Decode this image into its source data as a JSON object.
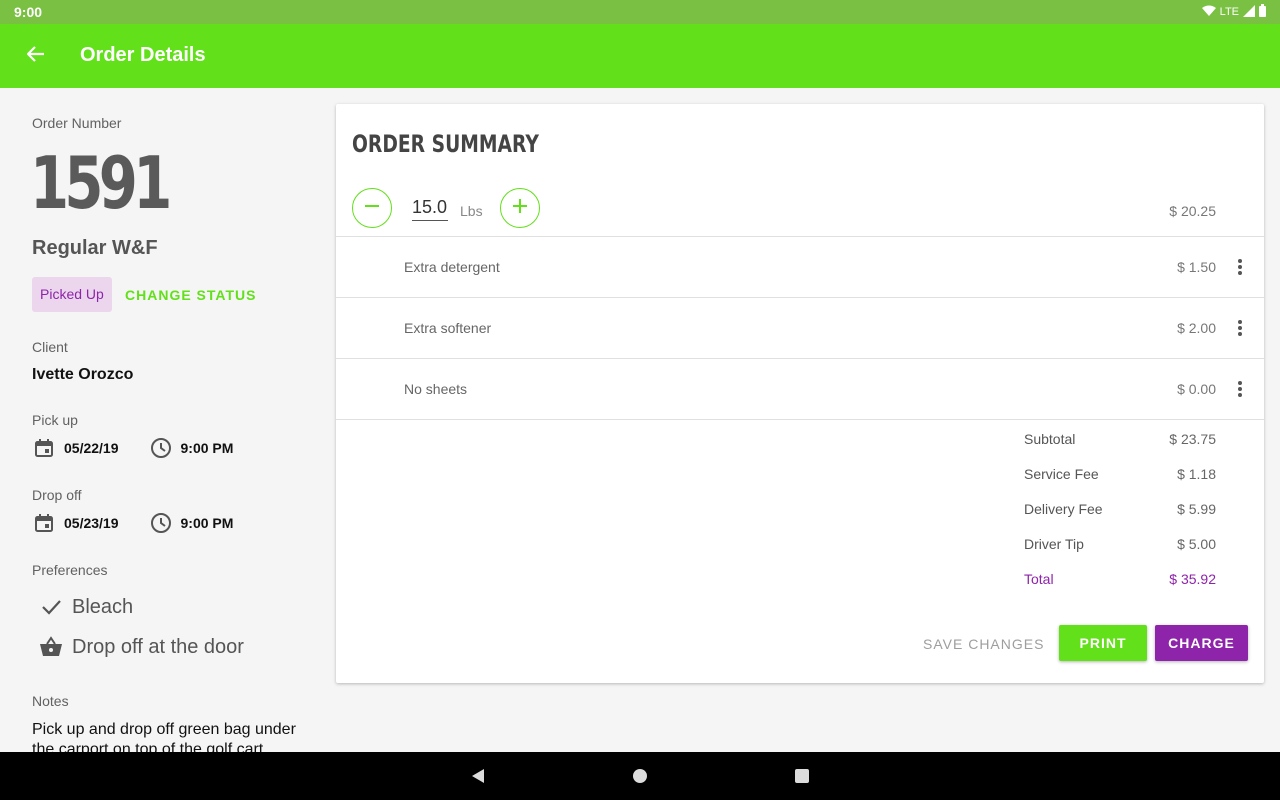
{
  "status_bar": {
    "time": "9:00",
    "network": "LTE"
  },
  "app_bar": {
    "title": "Order Details"
  },
  "order": {
    "number_label": "Order Number",
    "number": "1591",
    "service": "Regular W&F",
    "status": "Picked Up",
    "change_status": "CHANGE STATUS",
    "client_label": "Client",
    "client_name": "Ivette  Orozco",
    "pickup_label": "Pick up",
    "pickup_date": "05/22/19",
    "pickup_time": "9:00 PM",
    "dropoff_label": "Drop off",
    "dropoff_date": "05/23/19",
    "dropoff_time": "9:00 PM",
    "preferences_label": "Preferences",
    "preferences": [
      {
        "icon": "check-icon",
        "text": "Bleach"
      },
      {
        "icon": "basket-icon",
        "text": "Drop off at the door"
      }
    ],
    "notes_label": "Notes",
    "notes": "Pick up and drop off green bag under the carport on top of the golf cart."
  },
  "summary": {
    "title": "ORDER SUMMARY",
    "quantity": "15.0",
    "unit": "Lbs",
    "quantity_price": "$ 20.25",
    "items": [
      {
        "name": "Extra detergent",
        "price": "$ 1.50"
      },
      {
        "name": "Extra softener",
        "price": "$ 2.00"
      },
      {
        "name": "No sheets",
        "price": "$ 0.00"
      }
    ],
    "totals": [
      {
        "label": "Subtotal",
        "value": "$ 23.75"
      },
      {
        "label": "Service Fee",
        "value": "$ 1.18"
      },
      {
        "label": "Delivery Fee",
        "value": "$ 5.99"
      },
      {
        "label": "Driver Tip",
        "value": "$ 5.00"
      },
      {
        "label": "Total",
        "value": "$ 35.92"
      }
    ],
    "save_changes": "SAVE CHANGES",
    "print": "PRINT",
    "charge": "CHARGE"
  },
  "colors": {
    "primary": "#62e019",
    "accent": "#8e24aa",
    "status_bar": "#7ac143"
  }
}
